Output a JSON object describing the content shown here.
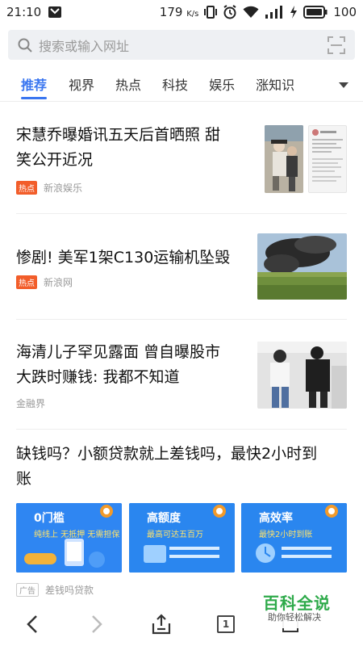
{
  "status_bar": {
    "time": "21:10",
    "net_speed": "179",
    "net_unit": "K/s",
    "battery": "100"
  },
  "search": {
    "placeholder": "搜索或输入网址"
  },
  "tabs": [
    {
      "label": "推荐",
      "active": true
    },
    {
      "label": "视界",
      "active": false
    },
    {
      "label": "热点",
      "active": false
    },
    {
      "label": "科技",
      "active": false
    },
    {
      "label": "娱乐",
      "active": false
    },
    {
      "label": "涨知识",
      "active": false
    }
  ],
  "feed": [
    {
      "title_line1": "宋慧乔曝婚讯五天后首晒照 甜",
      "title_line2": "笑公开近况",
      "tag": "热点",
      "source": "新浪娱乐"
    },
    {
      "title_line1": "惨剧! 美军1架C130运输机坠毁",
      "tag": "热点",
      "source": "新浪网"
    },
    {
      "title_line1": "海清儿子罕见露面 曾自曝股市",
      "title_line2": "大跌时赚钱: 我都不知道",
      "source": "金融界"
    },
    {
      "title_line1": "缺钱吗？小额贷款就上差钱吗，最快2小时到",
      "title_line2": "账",
      "ad_cards": [
        {
          "heading": "0门槛",
          "sub": "纯线上 无抵押 无需担保"
        },
        {
          "heading": "高额度",
          "sub": "最高可达五百万"
        },
        {
          "heading": "高效率",
          "sub": "最快2小时到账"
        }
      ],
      "ad_tag": "广告",
      "source": "差钱吗贷款"
    }
  ],
  "watermark": {
    "title": "百科全说",
    "subtitle": "助你轻松解决"
  },
  "toolbar": {
    "tab_count": "1"
  },
  "colors": {
    "accent": "#3a76f0",
    "hot_tag": "#f25d2a",
    "ad_card": "#2f7ff0"
  }
}
